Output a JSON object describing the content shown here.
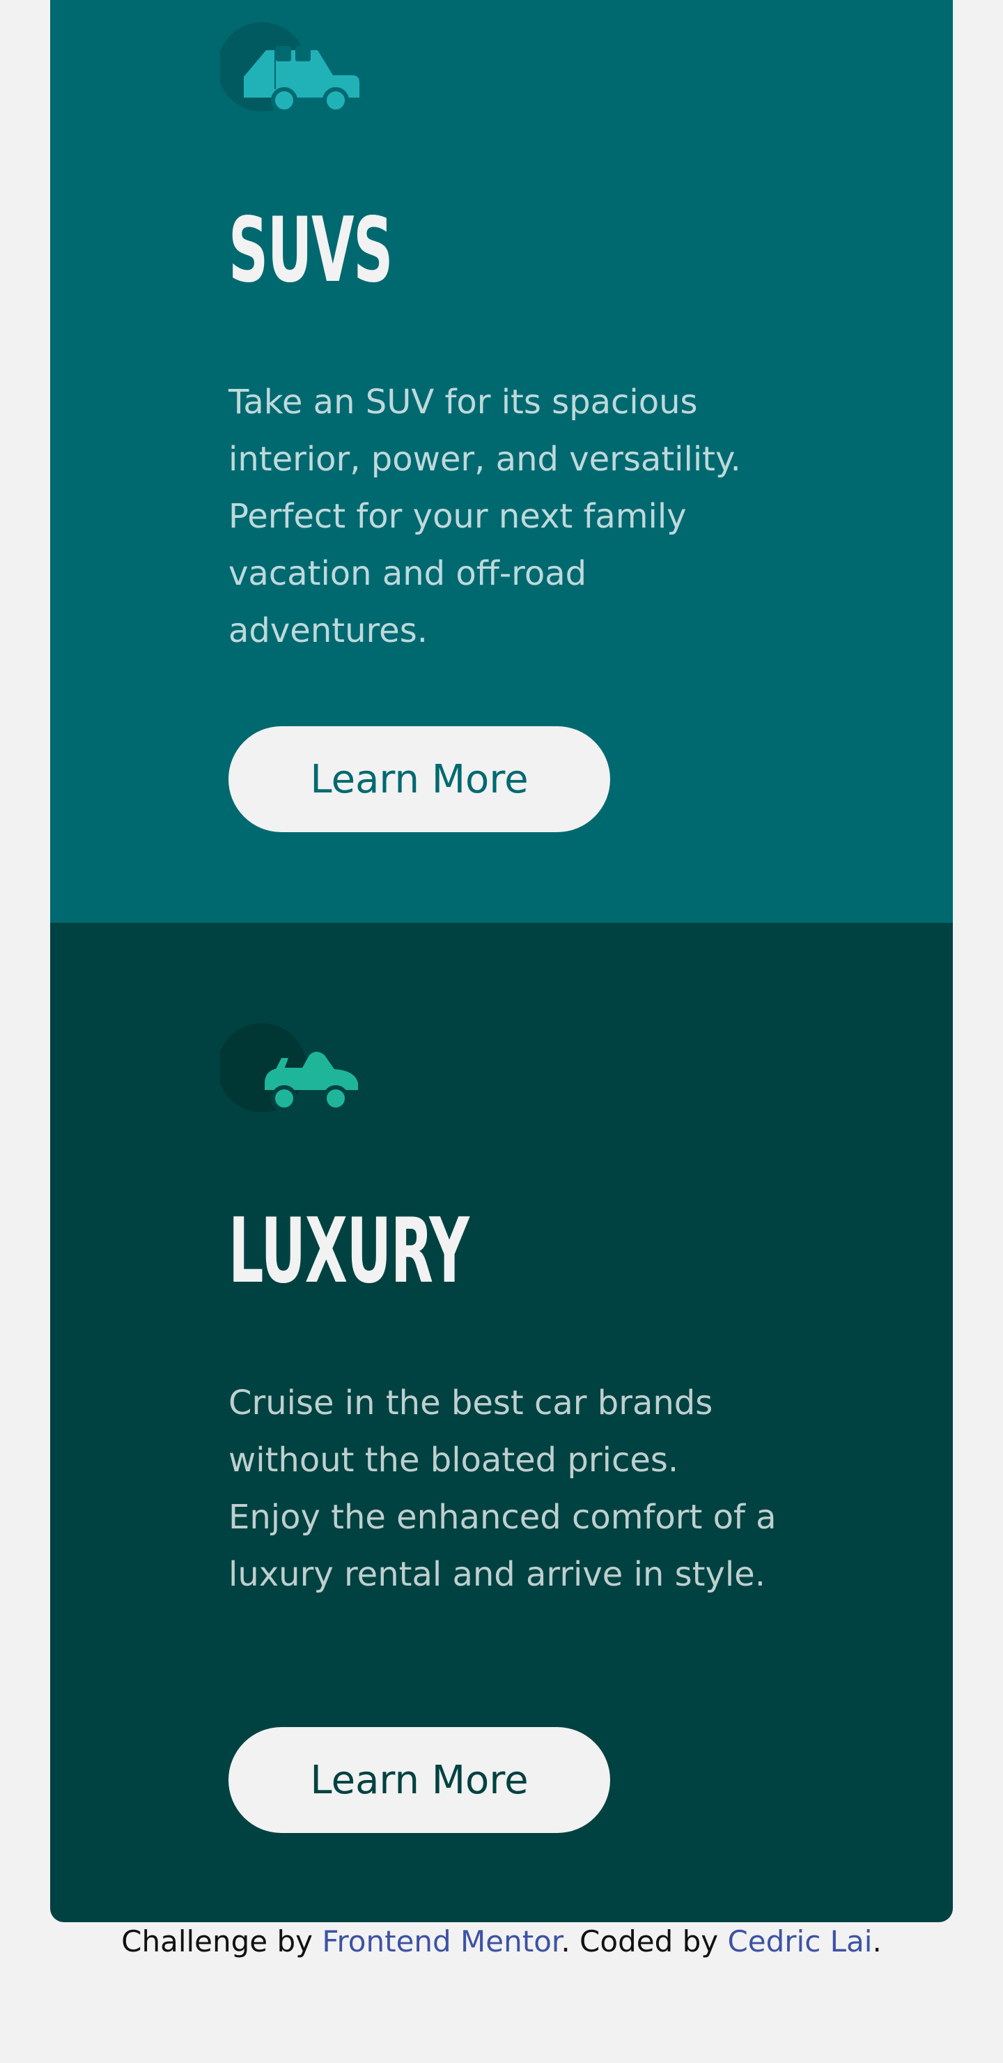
{
  "cards": [
    {
      "icon": "suv-icon",
      "title": "SUVS",
      "text": "Take an SUV for its spacious interior, power, and versatility. Perfect for your next family vacation and off-road adventures.",
      "button_label": "Learn More",
      "background": "#006970",
      "icon_color": "#21b2b8"
    },
    {
      "icon": "luxury-car-icon",
      "title": "LUXURY",
      "text": "Cruise in the best car brands without the bloated prices. Enjoy the enhanced comfort of a luxury rental and arrive in style.",
      "button_label": "Learn More",
      "background": "#004241",
      "icon_color": "#1fb59b"
    }
  ],
  "attribution": {
    "prefix": "Challenge by ",
    "challenge_link": "Frontend Mentor",
    "middle": ". Coded by ",
    "author_link": "Cedric Lai",
    "suffix": ".",
    "link_color": "#3e52a3"
  },
  "colors": {
    "page_background": "#f2f2f2",
    "button_background": "#f2f2f2"
  }
}
